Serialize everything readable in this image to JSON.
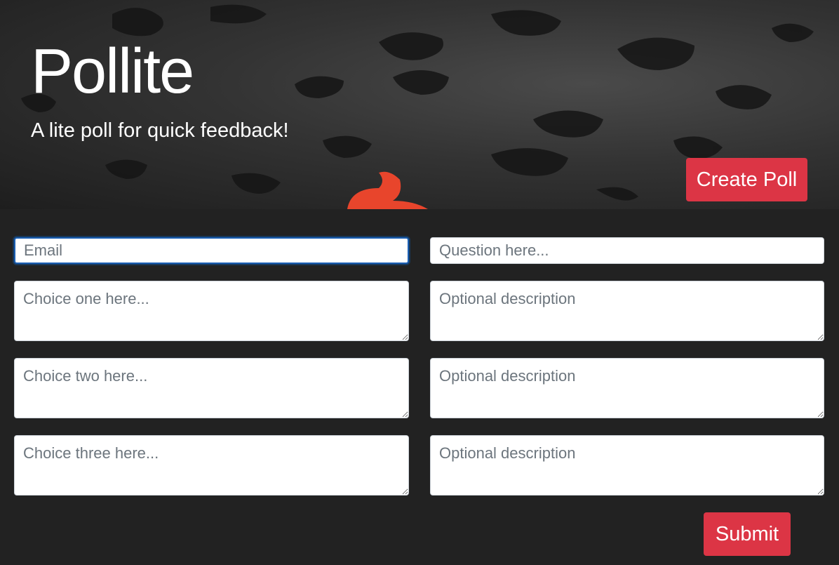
{
  "hero": {
    "title": "Pollite",
    "subtitle": "A lite poll for quick feedback!",
    "create_button": "Create Poll"
  },
  "form": {
    "email": {
      "placeholder": "Email",
      "value": ""
    },
    "question": {
      "placeholder": "Question here...",
      "value": ""
    },
    "choices": [
      {
        "placeholder": "Choice one here...",
        "description_placeholder": "Optional description"
      },
      {
        "placeholder": "Choice two here...",
        "description_placeholder": "Optional description"
      },
      {
        "placeholder": "Choice three here...",
        "description_placeholder": "Optional description"
      }
    ],
    "submit_button": "Submit"
  },
  "colors": {
    "accent": "#dc3545",
    "background": "#222222",
    "highlight_piece": "#e8452c"
  }
}
